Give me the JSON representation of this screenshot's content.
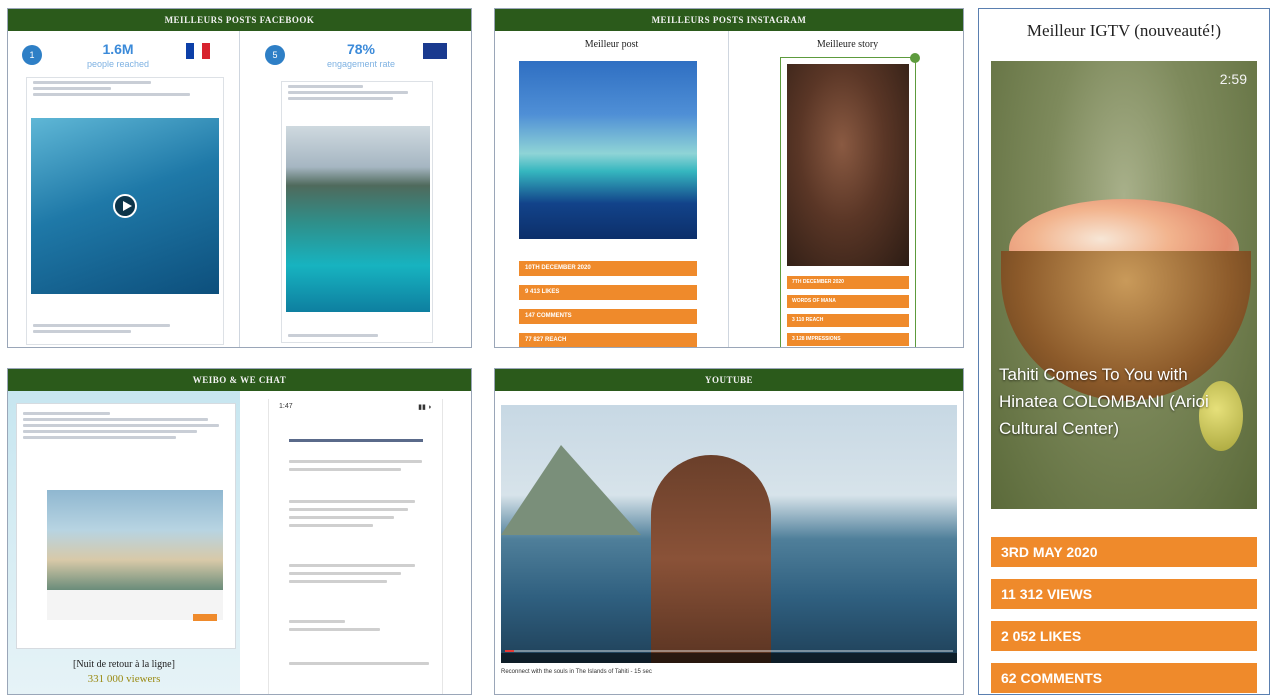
{
  "facebook": {
    "header": "MEILLEURS POSTS FACEBOOK",
    "left": {
      "number": "1",
      "stat": "1.6M",
      "stat_label": "people reached"
    },
    "right": {
      "number": "5",
      "stat": "78%",
      "stat_label": "engagement rate"
    }
  },
  "instagram": {
    "header": "MEILLEURS POSTS INSTAGRAM",
    "post": {
      "title": "Meilleur post",
      "stats": [
        "10th DECEMBER 2020",
        "9 413 LIKES",
        "147 COMMENTS",
        "77 827 REACH"
      ]
    },
    "story": {
      "title": "Meilleure story",
      "stats": [
        "7th DECEMBER 2020",
        "WORDS OF MANA",
        "3 110 REACH",
        "3 128 IMPRESSIONS"
      ]
    }
  },
  "igtv": {
    "title": "Meilleur IGTV (nouveauté!)",
    "duration": "2:59",
    "caption": "Tahiti Comes To You with Hinatea COLOMBANI (Arioi Cultural Center)",
    "stats": [
      "3rd MAY 2020",
      "11 312 VIEWS",
      "2 052 LIKES",
      "62 COMMENTS"
    ]
  },
  "wechat": {
    "header": "WEIBO & WE CHAT",
    "caption_line1": "[Nuit de retour à la ligne]",
    "caption_line2": "331 000 viewers",
    "phone_time": "1:47"
  },
  "youtube": {
    "header": "YOUTUBE",
    "video_caption": "Reconnect with the souls in The Islands of Tahiti - 15 sec",
    "progress": 0.02
  }
}
